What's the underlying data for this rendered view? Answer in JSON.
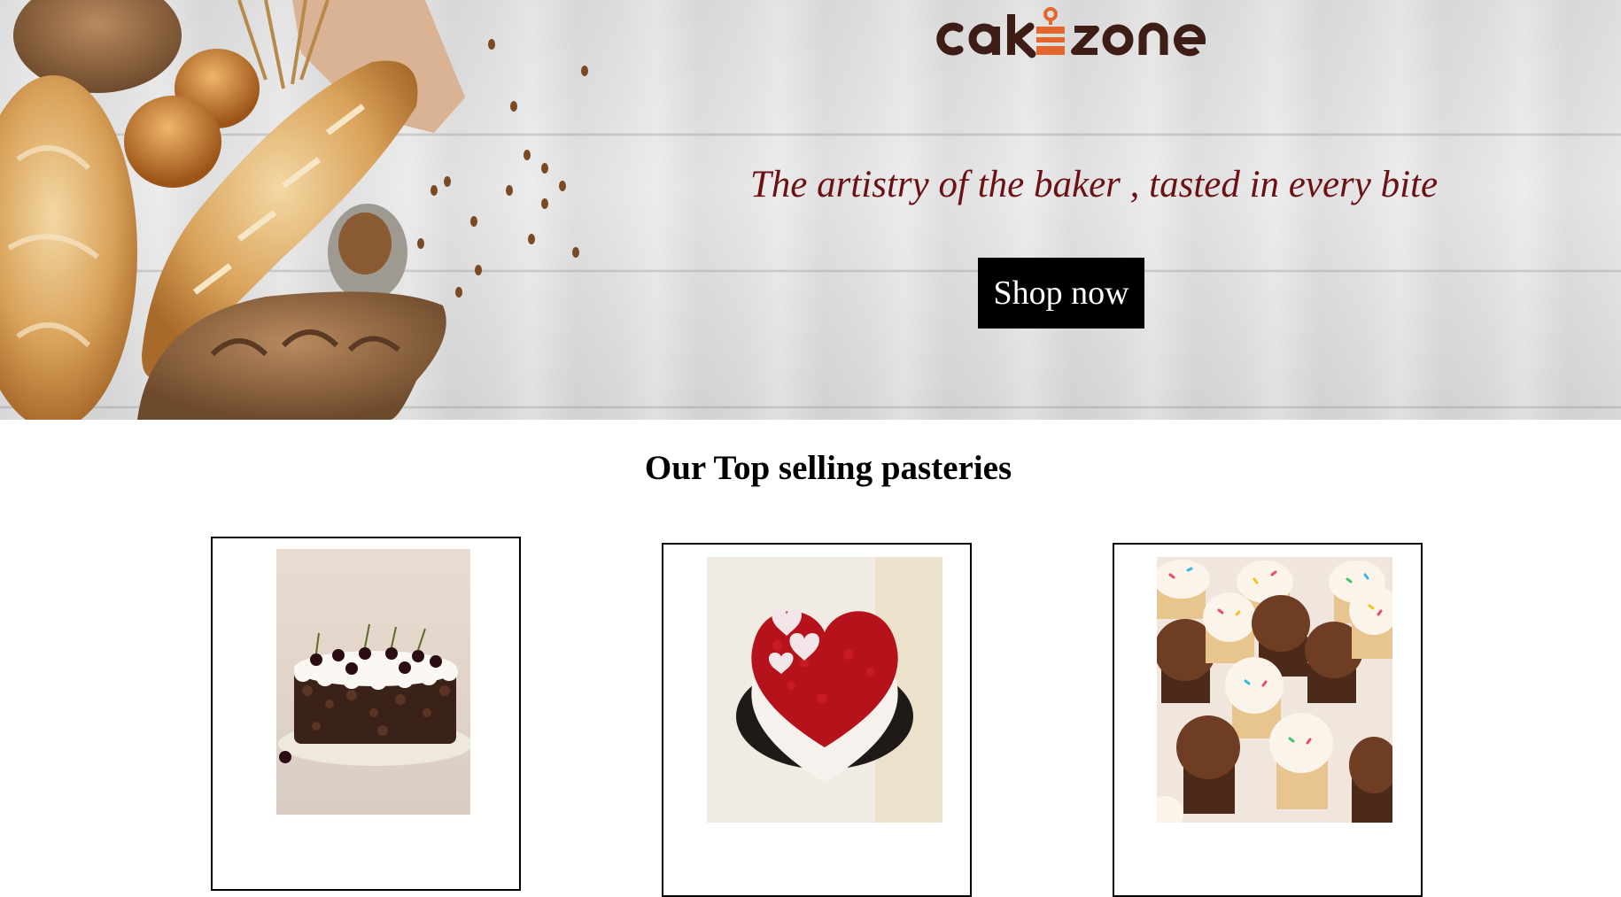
{
  "hero": {
    "logo_text": "cakezone",
    "tagline": "The artistry of the baker , tasted in every bite",
    "cta_label": "Shop now"
  },
  "products_section": {
    "title": "Our Top selling pasteries",
    "products": [
      {
        "name": "black-forest-cake",
        "image": "black-forest-cake-photo"
      },
      {
        "name": "red-velvet-heart-cake",
        "image": "red-velvet-heart-cake-photo"
      },
      {
        "name": "cupcakes",
        "image": "assorted-cupcakes-photo"
      }
    ]
  },
  "colors": {
    "tagline": "#6b1114",
    "logo_brown": "#3d1d16",
    "logo_accent": "#e2662e",
    "cta_bg": "#000000",
    "cta_text": "#ffffff"
  }
}
